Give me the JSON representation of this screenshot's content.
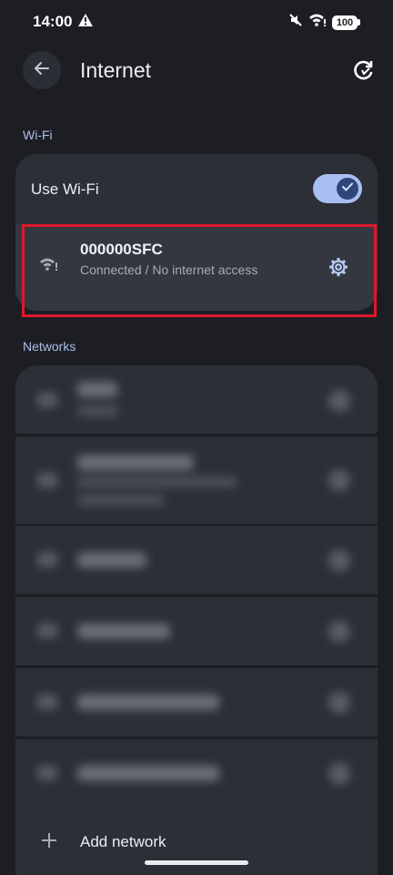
{
  "status_bar": {
    "time": "14:00",
    "battery": "100",
    "icons": [
      "warning-icon",
      "mute-icon",
      "wifi-alert-icon",
      "battery-icon"
    ]
  },
  "app_bar": {
    "title": "Internet",
    "icons": [
      "arrow-left-icon",
      "refresh-icon"
    ]
  },
  "wifi_section": {
    "label": "Wi-Fi",
    "toggle_label": "Use Wi-Fi",
    "toggle_on": true,
    "connected_network": {
      "name": "000000SFC",
      "status": "Connected / No internet access",
      "icons": [
        "wifi-no-internet-icon",
        "gear-icon"
      ]
    }
  },
  "networks_section": {
    "label": "Networks",
    "add_network_label": "Add network",
    "add_icon": "plus-icon"
  },
  "colors": {
    "background": "#1c1e24",
    "card": "#2c2f36",
    "accent": "#a9bff3",
    "highlight": "#e0162b"
  }
}
